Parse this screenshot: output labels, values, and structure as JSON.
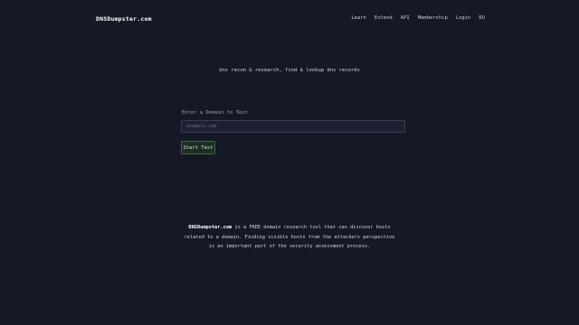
{
  "header": {
    "brand": "DNSDumpster.com",
    "nav": [
      {
        "label": "Learn"
      },
      {
        "label": "Extend"
      },
      {
        "label": "API"
      },
      {
        "label": "Membership"
      },
      {
        "label": "Login"
      },
      {
        "label": "RU"
      }
    ]
  },
  "hero": {
    "tagline": "dns recon & research, find & lookup dns records"
  },
  "search": {
    "label": "Enter a Domain to Test",
    "placeholder": "example.com",
    "button_label": "Start Test"
  },
  "description": {
    "brand": "DNSDumpster.com",
    "text": " is a FREE domain research tool that can discover hosts related to a domain. Finding visible hosts from the attackers perspective is an important part of the security assessment process."
  }
}
